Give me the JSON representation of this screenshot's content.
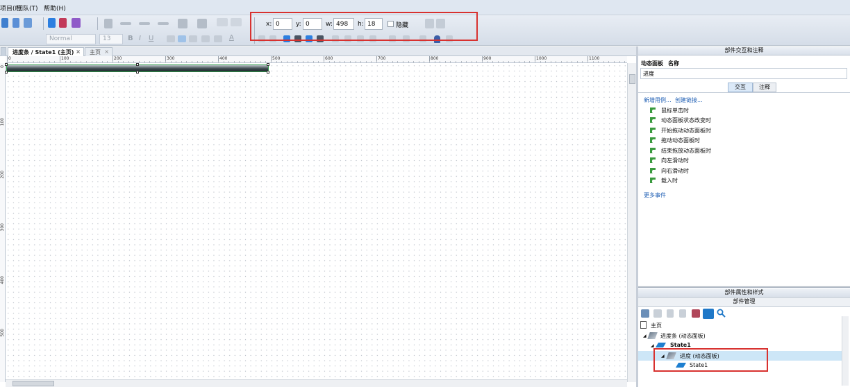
{
  "menu": {
    "items": [
      "项目(P)",
      "团队(T)",
      "帮助(H)"
    ]
  },
  "toolbar": {
    "font_family_value": "Normal",
    "font_size_value": "13",
    "bold_label": "B",
    "italic_label": "I",
    "underline_label": "U",
    "text_color_label": "A"
  },
  "geometry": {
    "x_label": "x:",
    "x_value": "0",
    "y_label": "y:",
    "y_value": "0",
    "w_label": "w:",
    "w_value": "498",
    "h_label": "h:",
    "h_value": "18",
    "hidden_label": "隐藏"
  },
  "tabs": [
    {
      "label": "进度条 / State1 (主页)",
      "close": "×",
      "active": true
    },
    {
      "label": "主页",
      "close": "×",
      "active": false
    }
  ],
  "ruler": {
    "h_ticks": [
      "0",
      "100",
      "200",
      "300",
      "400",
      "500",
      "600",
      "700",
      "800",
      "900",
      "1000",
      "1100"
    ],
    "v_ticks": [
      "0",
      "100",
      "200",
      "300",
      "400",
      "500"
    ]
  },
  "interactions_panel": {
    "title": "部件交互和注释",
    "widget_type": "动态面板",
    "name_label": "名称",
    "name_value": "进度",
    "tab_interactions": "交互",
    "tab_notes": "注释",
    "add_case_link": "新增用例...",
    "create_link": "创建链接...",
    "events": [
      "鼠标单击时",
      "动态面板状态改变时",
      "开始拖动动态面板时",
      "拖动动态面板时",
      "结束拖放动态面板时",
      "向左滑动时",
      "向右滑动时",
      "载入时"
    ],
    "more_events": "更多事件"
  },
  "properties_panel": {
    "title": "部件属性和样式",
    "manager_title": "部件管理"
  },
  "tree": [
    {
      "label": "主页",
      "level": 0,
      "icon": "page-icon"
    },
    {
      "label": "进度条 (动态面板)",
      "level": 1,
      "icon": "dynamic-panel-icon"
    },
    {
      "label": "State1",
      "level": 2,
      "icon": "state-icon"
    },
    {
      "label": "进度 (动态面板)",
      "level": 3,
      "icon": "dynamic-panel-icon",
      "selected": true
    },
    {
      "label": "State1",
      "level": 4,
      "icon": "state-icon"
    }
  ],
  "colors": {
    "annotation_red": "#d8312f",
    "link_blue": "#1f5fb4",
    "selection_blue": "#cde6f7"
  }
}
